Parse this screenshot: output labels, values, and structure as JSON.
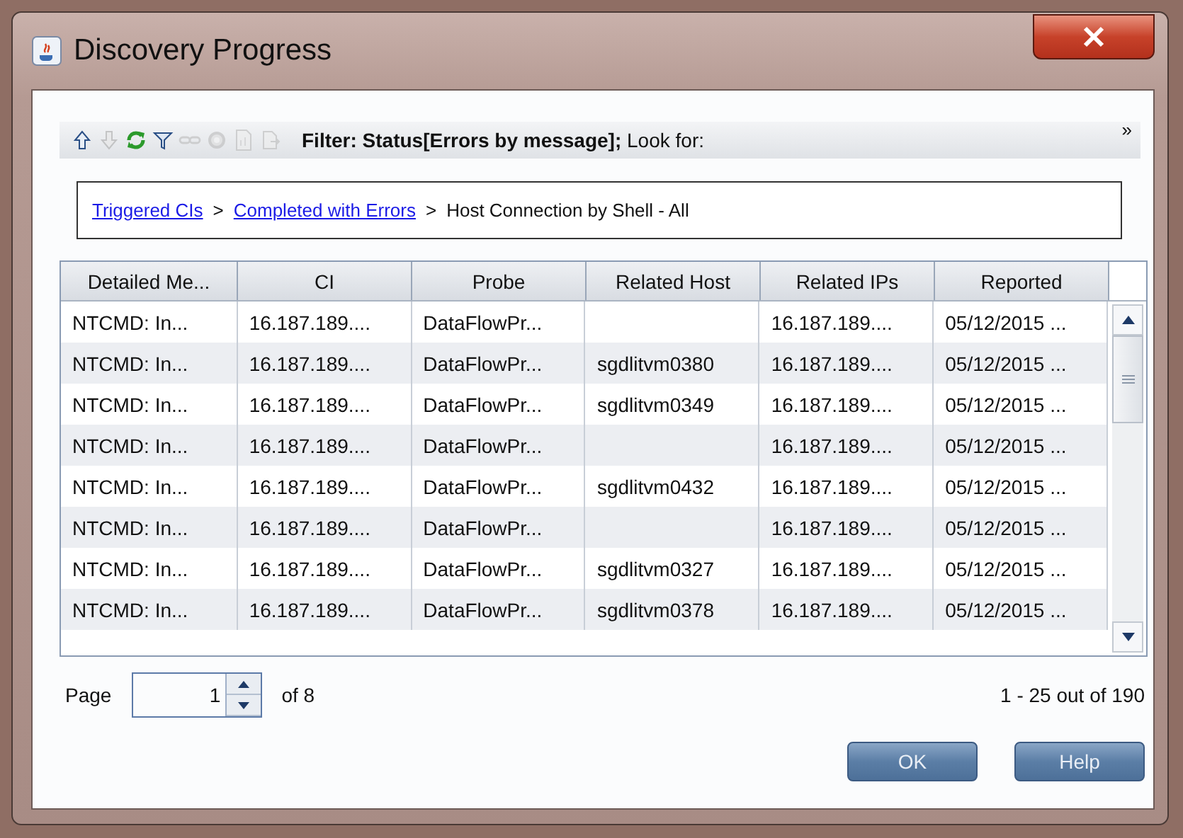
{
  "window": {
    "title": "Discovery Progress"
  },
  "toolbar": {
    "buttons": [
      {
        "kind": "up",
        "disabled": false
      },
      {
        "kind": "down",
        "disabled": true
      },
      {
        "kind": "refresh",
        "disabled": false
      },
      {
        "kind": "filter",
        "disabled": false
      },
      {
        "kind": "link",
        "disabled": true
      },
      {
        "kind": "tools",
        "disabled": true
      },
      {
        "kind": "report",
        "disabled": true
      },
      {
        "kind": "export",
        "disabled": true
      }
    ],
    "filter_text": "**Filter: Status[Errors by message];** Look for:",
    "overflow": "»"
  },
  "breadcrumb": [
    {
      "kind": "link",
      "label": "Triggered CIs"
    },
    {
      "kind": "separator",
      "label": ">"
    },
    {
      "kind": "link",
      "label": "Completed with Errors"
    },
    {
      "kind": "separator",
      "label": ">"
    },
    {
      "kind": "text",
      "label": "Host Connection by Shell - All"
    }
  ],
  "table": {
    "columns": [
      "Detailed Me...",
      "CI",
      "Probe",
      "Related Host",
      "Related IPs",
      "Reported"
    ],
    "rows": [
      [
        "NTCMD: In...",
        "16.187.189....",
        "DataFlowPr...",
        "",
        "16.187.189....",
        "05/12/2015 ..."
      ],
      [
        "NTCMD: In...",
        "16.187.189....",
        "DataFlowPr...",
        "sgdlitvm0380",
        "16.187.189....",
        "05/12/2015 ..."
      ],
      [
        "NTCMD: In...",
        "16.187.189....",
        "DataFlowPr...",
        "sgdlitvm0349",
        "16.187.189....",
        "05/12/2015 ..."
      ],
      [
        "NTCMD: In...",
        "16.187.189....",
        "DataFlowPr...",
        "",
        "16.187.189....",
        "05/12/2015 ..."
      ],
      [
        "NTCMD: In...",
        "16.187.189....",
        "DataFlowPr...",
        "sgdlitvm0432",
        "16.187.189....",
        "05/12/2015 ..."
      ],
      [
        "NTCMD: In...",
        "16.187.189....",
        "DataFlowPr...",
        "",
        "16.187.189....",
        "05/12/2015 ..."
      ],
      [
        "NTCMD: In...",
        "16.187.189....",
        "DataFlowPr...",
        "sgdlitvm0327",
        "16.187.189....",
        "05/12/2015 ..."
      ],
      [
        "NTCMD: In...",
        "16.187.189....",
        "DataFlowPr...",
        "sgdlitvm0378",
        "16.187.189....",
        "05/12/2015 ..."
      ]
    ]
  },
  "pager": {
    "label": "Page",
    "value": "1",
    "of": "of 8",
    "summary": "1 - 25 out of 190"
  },
  "buttons": [
    "OK",
    "Help"
  ]
}
